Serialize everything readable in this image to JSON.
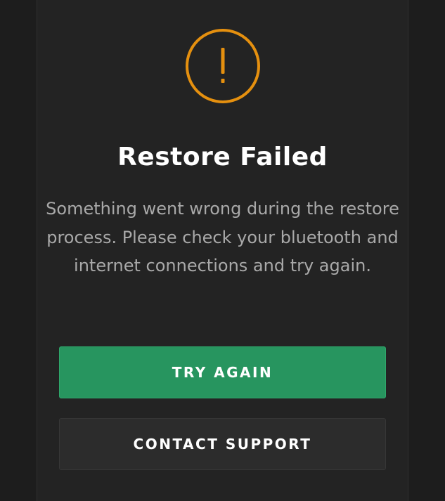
{
  "dialog": {
    "icon": "exclamation-circle-icon",
    "title": "Restore Failed",
    "message": "Something went wrong during the restore process. Please check your bluetooth and internet connections and try again.",
    "primary_button_label": "TRY AGAIN",
    "secondary_button_label": "CONTACT SUPPORT"
  },
  "colors": {
    "background": "#1b1b1b",
    "panel": "#232323",
    "warning_accent": "#e5900f",
    "primary_button": "#27955f",
    "secondary_button": "#2c2c2c",
    "title_text": "#ffffff",
    "body_text": "#a9a9a9"
  }
}
